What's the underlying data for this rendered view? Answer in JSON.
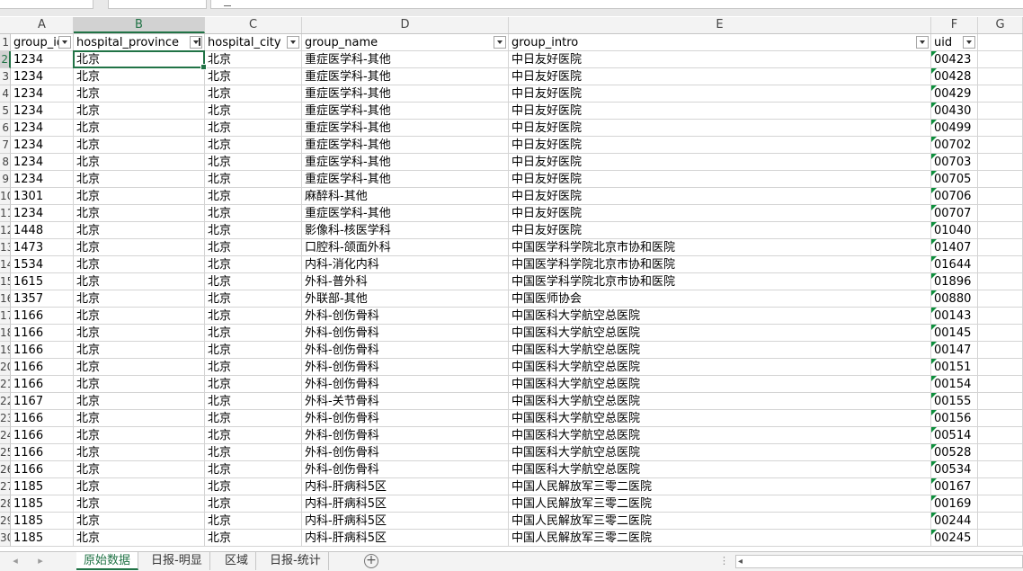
{
  "columns": [
    {
      "letter": "A",
      "width": 70
    },
    {
      "letter": "B",
      "width": 146
    },
    {
      "letter": "C",
      "width": 108
    },
    {
      "letter": "D",
      "width": 230
    },
    {
      "letter": "E",
      "width": 470
    },
    {
      "letter": "F",
      "width": 52
    },
    {
      "letter": "G",
      "width": 50
    }
  ],
  "selected_column": "B",
  "selected_row": "2",
  "header_row": {
    "row_number": "1",
    "cells": [
      "group_id",
      "hospital_province",
      "hospital_city",
      "group_name",
      "group_intro",
      "uid"
    ]
  },
  "rows": [
    {
      "n": "2",
      "cells": [
        "1234",
        "北京",
        "北京",
        "重症医学科-其他",
        "中日友好医院",
        "00423"
      ]
    },
    {
      "n": "3",
      "cells": [
        "1234",
        "北京",
        "北京",
        "重症医学科-其他",
        "中日友好医院",
        "00428"
      ]
    },
    {
      "n": "4",
      "cells": [
        "1234",
        "北京",
        "北京",
        "重症医学科-其他",
        "中日友好医院",
        "00429"
      ]
    },
    {
      "n": "5",
      "cells": [
        "1234",
        "北京",
        "北京",
        "重症医学科-其他",
        "中日友好医院",
        "00430"
      ]
    },
    {
      "n": "6",
      "cells": [
        "1234",
        "北京",
        "北京",
        "重症医学科-其他",
        "中日友好医院",
        "00499"
      ]
    },
    {
      "n": "7",
      "cells": [
        "1234",
        "北京",
        "北京",
        "重症医学科-其他",
        "中日友好医院",
        "00702"
      ]
    },
    {
      "n": "8",
      "cells": [
        "1234",
        "北京",
        "北京",
        "重症医学科-其他",
        "中日友好医院",
        "00703"
      ]
    },
    {
      "n": "9",
      "cells": [
        "1234",
        "北京",
        "北京",
        "重症医学科-其他",
        "中日友好医院",
        "00705"
      ]
    },
    {
      "n": "10",
      "cells": [
        "1301",
        "北京",
        "北京",
        "麻醉科-其他",
        "中日友好医院",
        "00706"
      ]
    },
    {
      "n": "11",
      "cells": [
        "1234",
        "北京",
        "北京",
        "重症医学科-其他",
        "中日友好医院",
        "00707"
      ]
    },
    {
      "n": "12",
      "cells": [
        "1448",
        "北京",
        "北京",
        "影像科-核医学科",
        "中日友好医院",
        "01040"
      ]
    },
    {
      "n": "13",
      "cells": [
        "1473",
        "北京",
        "北京",
        "口腔科-颌面外科",
        "中国医学科学院北京市协和医院",
        "01407"
      ]
    },
    {
      "n": "14",
      "cells": [
        "1534",
        "北京",
        "北京",
        "内科-消化内科",
        "中国医学科学院北京市协和医院",
        "01644"
      ]
    },
    {
      "n": "15",
      "cells": [
        "1615",
        "北京",
        "北京",
        "外科-普外科",
        "中国医学科学院北京市协和医院",
        "01896"
      ]
    },
    {
      "n": "16",
      "cells": [
        "1357",
        "北京",
        "北京",
        "外联部-其他",
        "中国医师协会",
        "00880"
      ]
    },
    {
      "n": "17",
      "cells": [
        "1166",
        "北京",
        "北京",
        "外科-创伤骨科",
        "中国医科大学航空总医院",
        "00143"
      ]
    },
    {
      "n": "18",
      "cells": [
        "1166",
        "北京",
        "北京",
        "外科-创伤骨科",
        "中国医科大学航空总医院",
        "00145"
      ]
    },
    {
      "n": "19",
      "cells": [
        "1166",
        "北京",
        "北京",
        "外科-创伤骨科",
        "中国医科大学航空总医院",
        "00147"
      ]
    },
    {
      "n": "20",
      "cells": [
        "1166",
        "北京",
        "北京",
        "外科-创伤骨科",
        "中国医科大学航空总医院",
        "00151"
      ]
    },
    {
      "n": "21",
      "cells": [
        "1166",
        "北京",
        "北京",
        "外科-创伤骨科",
        "中国医科大学航空总医院",
        "00154"
      ]
    },
    {
      "n": "22",
      "cells": [
        "1167",
        "北京",
        "北京",
        "外科-关节骨科",
        "中国医科大学航空总医院",
        "00155"
      ]
    },
    {
      "n": "23",
      "cells": [
        "1166",
        "北京",
        "北京",
        "外科-创伤骨科",
        "中国医科大学航空总医院",
        "00156"
      ]
    },
    {
      "n": "24",
      "cells": [
        "1166",
        "北京",
        "北京",
        "外科-创伤骨科",
        "中国医科大学航空总医院",
        "00514"
      ]
    },
    {
      "n": "25",
      "cells": [
        "1166",
        "北京",
        "北京",
        "外科-创伤骨科",
        "中国医科大学航空总医院",
        "00528"
      ]
    },
    {
      "n": "26",
      "cells": [
        "1166",
        "北京",
        "北京",
        "外科-创伤骨科",
        "中国医科大学航空总医院",
        "00534"
      ]
    },
    {
      "n": "27",
      "cells": [
        "1185",
        "北京",
        "北京",
        "内科-肝病科5区",
        "中国人民解放军三零二医院",
        "00167"
      ]
    },
    {
      "n": "28",
      "cells": [
        "1185",
        "北京",
        "北京",
        "内科-肝病科5区",
        "中国人民解放军三零二医院",
        "00169"
      ]
    },
    {
      "n": "29",
      "cells": [
        "1185",
        "北京",
        "北京",
        "内科-肝病科5区",
        "中国人民解放军三零二医院",
        "00244"
      ]
    },
    {
      "n": "30",
      "cells": [
        "1185",
        "北京",
        "北京",
        "内科-肝病科5区",
        "中国人民解放军三零二医院",
        "00245"
      ]
    }
  ],
  "sheet_tabs": [
    {
      "label": "原始数据",
      "active": true
    },
    {
      "label": "日报-明显",
      "active": false
    },
    {
      "label": "区域",
      "active": false
    },
    {
      "label": "日报-统计",
      "active": false
    }
  ],
  "icons": {
    "add_sheet": "plus-circle-icon",
    "filter": "filter-dropdown-icon",
    "nav_prev": "chevron-left-icon",
    "nav_next": "chevron-right-icon"
  },
  "colors": {
    "accent": "#217346",
    "gridline": "#d4d4d4",
    "header_bg": "#f3f3f3",
    "text_number_marker": "#0d8f3c"
  }
}
